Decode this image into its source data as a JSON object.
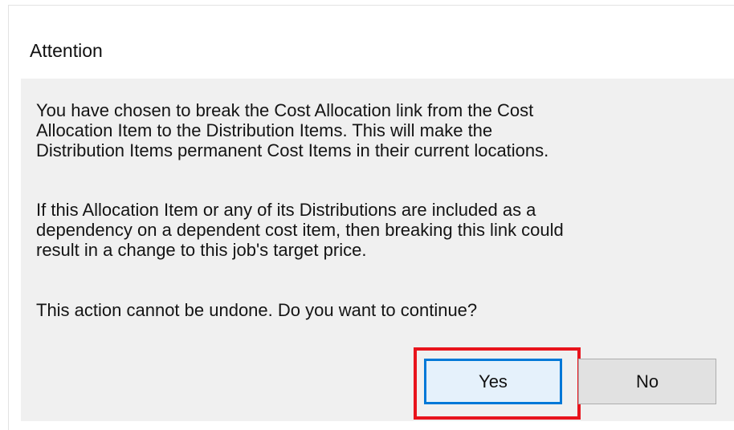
{
  "dialog": {
    "title": "Attention",
    "message_1": "You have chosen to break the Cost Allocation link from the Cost\nAllocation Item to the Distribution Items.  This will make the\nDistribution Items permanent Cost Items in their current locations.",
    "message_2": "If this Allocation Item or any of its Distributions are included as a\ndependency on a dependent cost item, then breaking this link could\nresult in a change to this job's target price.",
    "message_3": "This action cannot be undone.  Do you want to continue?",
    "yes_label": "Yes",
    "no_label": "No"
  },
  "colors": {
    "highlight_border": "#e8141c",
    "focused_button_border": "#0078d7",
    "content_background": "#f0f0f0"
  }
}
